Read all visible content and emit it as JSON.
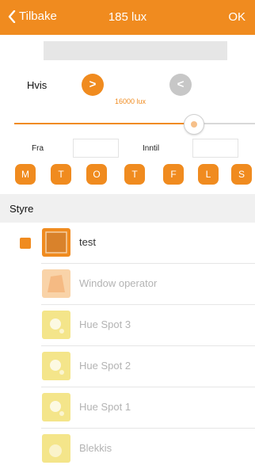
{
  "header": {
    "back_label": "Tilbake",
    "title": "185 lux",
    "ok_label": "OK"
  },
  "condition": {
    "label": "Hvis",
    "greater_symbol": ">",
    "less_symbol": "<",
    "threshold_label": "16000 lux",
    "slider_fraction": 0.74
  },
  "time": {
    "from_label": "Fra",
    "until_label": "Inntil",
    "from_value": "",
    "until_value": ""
  },
  "days": [
    "M",
    "T",
    "O",
    "T",
    "F",
    "L",
    "S"
  ],
  "section_title": "Styre",
  "devices": [
    {
      "name": "test",
      "selected": true
    },
    {
      "name": "Window operator",
      "selected": false
    },
    {
      "name": "Hue Spot 3",
      "selected": false
    },
    {
      "name": "Hue Spot 2",
      "selected": false
    },
    {
      "name": "Hue Spot 1",
      "selected": false
    },
    {
      "name": "Blekkis",
      "selected": false
    }
  ],
  "colors": {
    "accent": "#f08b1f",
    "inactive_circle": "#c7c7c7",
    "section_bg": "#f0f0f0"
  }
}
